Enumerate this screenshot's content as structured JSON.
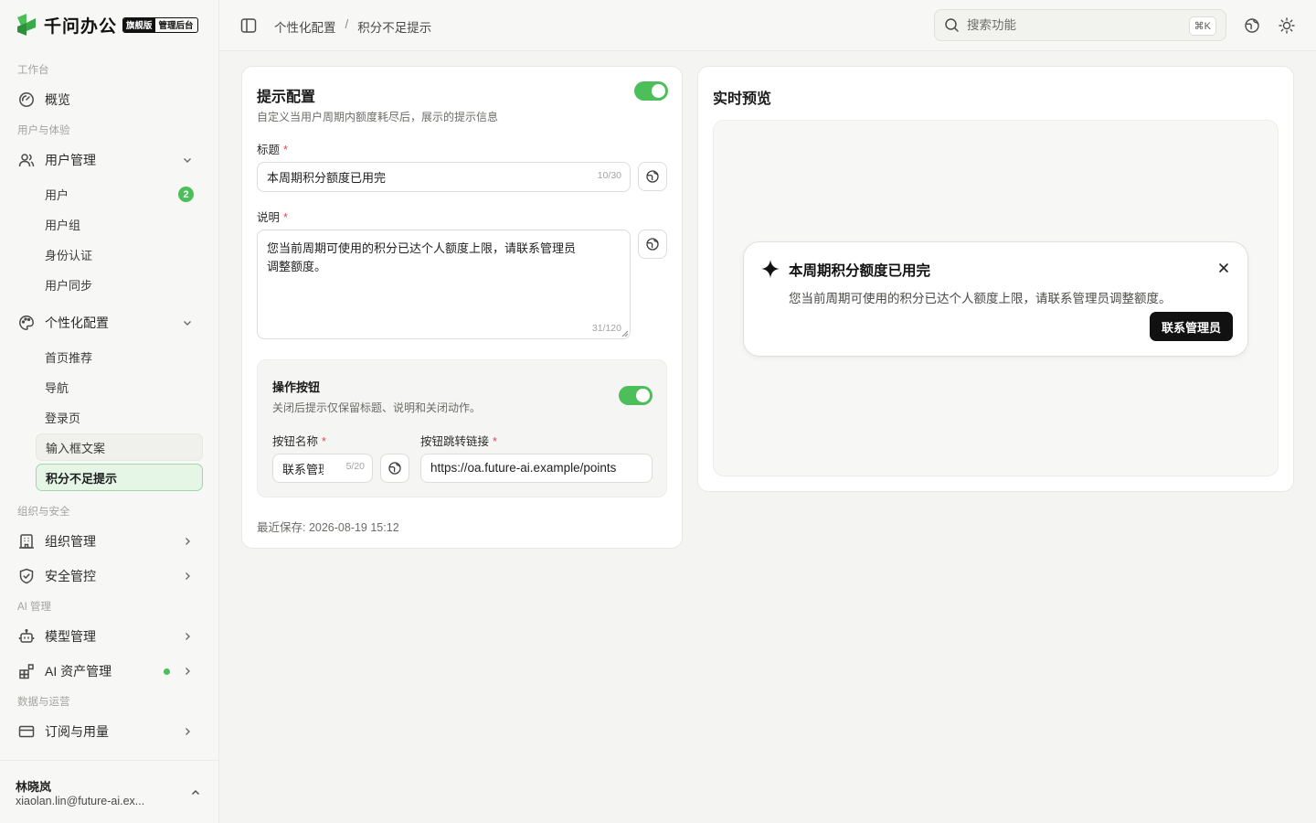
{
  "brand": {
    "name": "千问办公",
    "badge_edition": "旗舰版",
    "badge_admin": "管理后台"
  },
  "sidebar": {
    "sections": {
      "workbench": "工作台",
      "users": "用户与体验",
      "org": "组织与安全",
      "ai": "AI 管理",
      "data": "数据与运营"
    },
    "overview": "概览",
    "user_mgmt": {
      "label": "用户管理",
      "items": [
        {
          "label": "用户",
          "count": "2"
        },
        {
          "label": "用户组"
        },
        {
          "label": "身份认证"
        },
        {
          "label": "用户同步"
        }
      ]
    },
    "personal": {
      "label": "个性化配置",
      "items": [
        {
          "label": "首页推荐"
        },
        {
          "label": "导航"
        },
        {
          "label": "登录页"
        },
        {
          "label": "输入框文案"
        },
        {
          "label": "积分不足提示"
        }
      ]
    },
    "org_mgmt": "组织管理",
    "security": "安全管控",
    "model_mgmt": "模型管理",
    "ai_assets": "AI 资产管理",
    "subscription": "订阅与用量"
  },
  "user": {
    "name": "林晓岚",
    "email": "xiaolan.lin@future-ai.ex..."
  },
  "topbar": {
    "breadcrumb": [
      "个性化配置",
      "积分不足提示"
    ],
    "search_placeholder": "搜索功能",
    "shortcut": "⌘K"
  },
  "config": {
    "title": "提示配置",
    "description": "自定义当用户周期内额度耗尽后，展示的提示信息",
    "enabled": true,
    "title_label": "标题",
    "title_value": "本周期积分额度已用完",
    "title_count": "10/30",
    "desc_label": "说明",
    "desc_value": "您当前周期可使用的积分已达个人额度上限，请联系管理员调整额度。",
    "desc_count": "31/120",
    "action": {
      "title": "操作按钮",
      "description": "关闭后提示仅保留标题、说明和关闭动作。",
      "enabled": true,
      "name_label": "按钮名称",
      "name_value": "联系管理员",
      "name_count": "5/20",
      "link_label": "按钮跳转链接",
      "link_value": "https://oa.future-ai.example/points"
    },
    "last_saved": "最近保存: 2026-08-19 15:12"
  },
  "preview": {
    "title": "实时预览",
    "toast_title": "本周期积分额度已用完",
    "toast_desc": "您当前周期可使用的积分已达个人额度上限，请联系管理员调整额度。",
    "toast_button": "联系管理员"
  },
  "colors": {
    "accent": "#4cbf5a",
    "active_bg": "#e5f5e6",
    "required": "#e5484d",
    "dark_button": "#111111"
  }
}
